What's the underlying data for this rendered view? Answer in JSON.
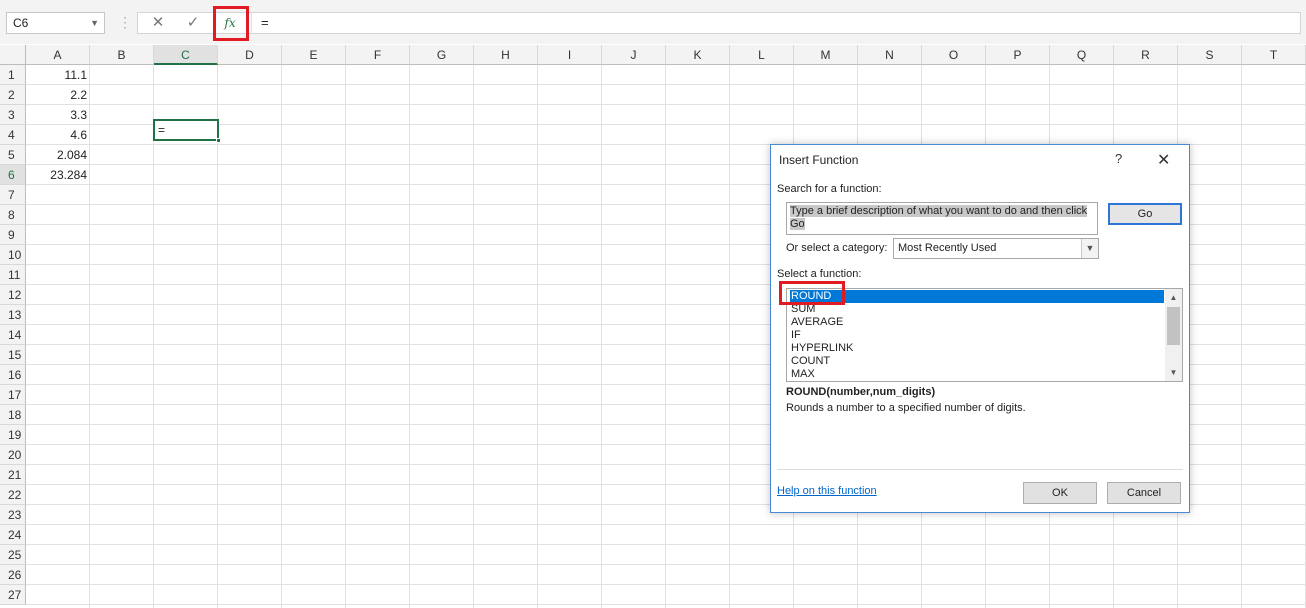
{
  "name_box": {
    "value": "C6"
  },
  "formula_bar": {
    "value": "=",
    "fx_label": "fx"
  },
  "columns": [
    "A",
    "B",
    "C",
    "D",
    "E",
    "F",
    "G",
    "H",
    "I",
    "J",
    "K",
    "L",
    "M",
    "N",
    "O",
    "P",
    "Q",
    "R",
    "S",
    "T"
  ],
  "rows": [
    "1",
    "2",
    "3",
    "4",
    "5",
    "6",
    "7",
    "8",
    "9",
    "10",
    "11",
    "12",
    "13",
    "14",
    "15",
    "16",
    "17",
    "18",
    "19",
    "20",
    "21",
    "22",
    "23",
    "24",
    "25",
    "26",
    "27"
  ],
  "cells": {
    "A1": "11.1",
    "A2": "2.2",
    "A3": "3.3",
    "A4": "4.6",
    "A5": "2.084",
    "A6": "23.284",
    "C6": "="
  },
  "dialog": {
    "title": "Insert Function",
    "help_glyph": "?",
    "close_glyph": "✕",
    "search_label": "Search for a function:",
    "search_value": "Type a brief description of what you want to do and then click Go",
    "go_label": "Go",
    "category_label": "Or select a category:",
    "category_value": "Most Recently Used",
    "select_label": "Select a function:",
    "functions": [
      "ROUND",
      "SUM",
      "AVERAGE",
      "IF",
      "HYPERLINK",
      "COUNT",
      "MAX"
    ],
    "signature": "ROUND(number,num_digits)",
    "description": "Rounds a number to a specified number of digits.",
    "help_link": "Help on this function",
    "ok_label": "OK",
    "cancel_label": "Cancel"
  },
  "colors": {
    "excel_green": "#217346",
    "highlight_red": "#e01b24",
    "selection_blue": "#0078d7"
  }
}
